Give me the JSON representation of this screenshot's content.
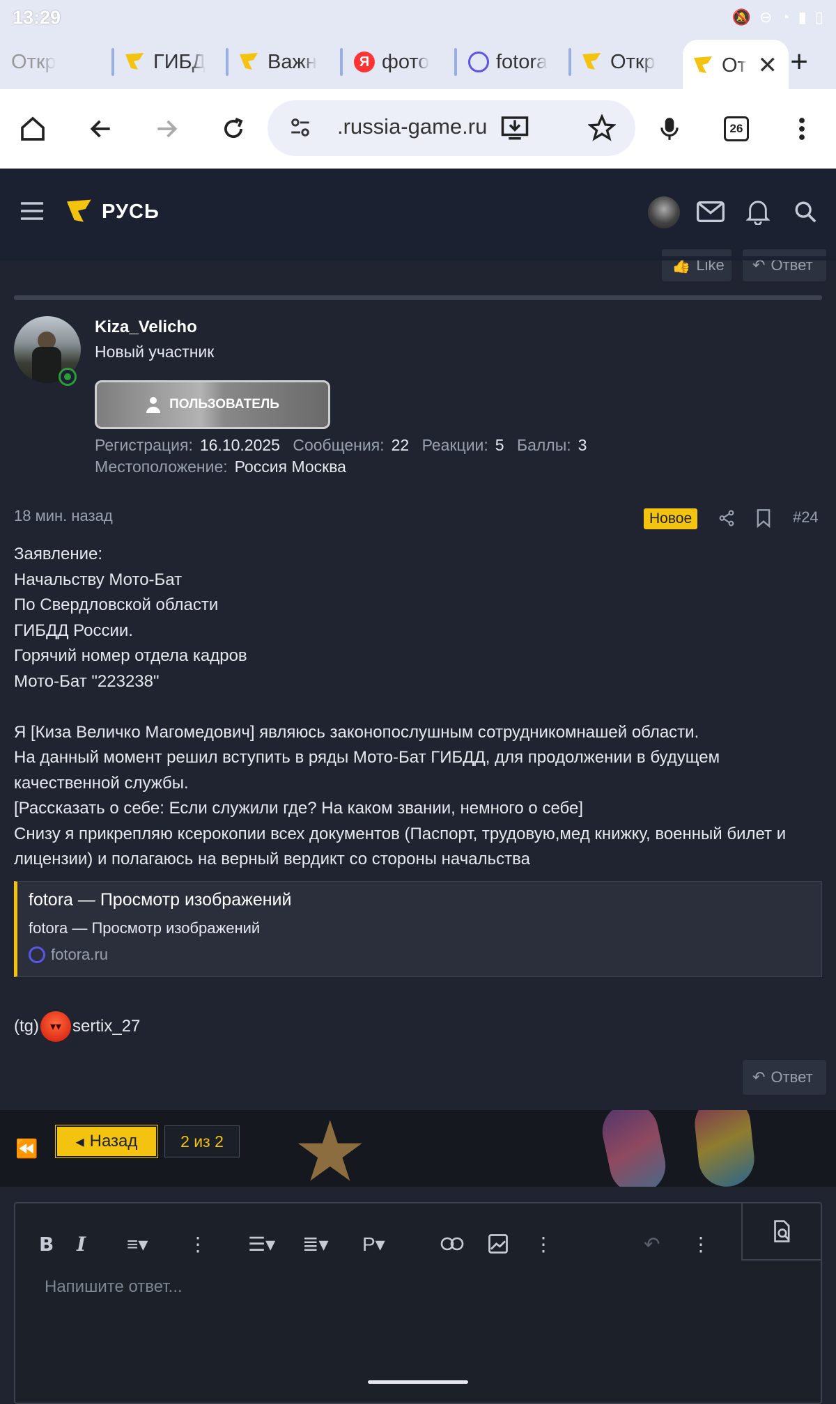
{
  "status_bar": {
    "time": "13:29"
  },
  "tabs": [
    {
      "label": "Откр",
      "icon": "flag-icon",
      "dim": true
    },
    {
      "label": "ГИБД",
      "icon": "flag-icon"
    },
    {
      "label": "Важн",
      "icon": "flag-icon"
    },
    {
      "label": "фото",
      "icon": "yandex-icon"
    },
    {
      "label": "fotora",
      "icon": "ring-icon"
    },
    {
      "label": "Откр",
      "icon": "flag-icon"
    },
    {
      "label": "От",
      "icon": "flag-icon",
      "active": true
    }
  ],
  "toolbar": {
    "url": ".russia-game.ru",
    "tab_count": "26"
  },
  "site": {
    "logo_text": "РУСЬ",
    "brand_color": "#f4c30f"
  },
  "actions": {
    "like_label": "Like",
    "reply_label": "Ответ"
  },
  "user": {
    "name": "Kiza_Velicho",
    "title": "Новый участник",
    "role": "ПОЛЬЗОВАТЕЛЬ",
    "stats": [
      {
        "key": "Регистрация:",
        "value": "16.10.2025"
      },
      {
        "key": "Сообщения:",
        "value": "22"
      },
      {
        "key": "Реакции:",
        "value": "5"
      },
      {
        "key": "Баллы:",
        "value": "3"
      }
    ],
    "location_key": "Местоположение:",
    "location_value": "Россия Москва"
  },
  "post": {
    "date": "18 мин. назад",
    "badge": "Новое",
    "number": "#24",
    "body": "Заявление:\nНачальству Мото-Бат\nПо Свердловской области\nГИБДД России.\nГорячий номер отдела кадров\nМото-Бат \"223238\"\n\nЯ [Киза Величко Магомедович] являюсь законопослушным сотрудникомнашей области.\nНа данный момент решил вступить в ряды Мото-Бат ГИБДД, для продолжении в будущем качественной службы.\n[Рассказать о себе: Если служили где? На каком звании, немного о себе]\nСнизу я прикрепляю ксерокопии всех документов (Паспорт, трудовую,мед книжку, военный билет и лицензии) и полагаюсь на верный вердикт со стороны начальства",
    "link_card": {
      "title": "fotora — Просмотр изображений",
      "description": "fotora — Просмотр изображений",
      "domain": "fotora.ru"
    },
    "signature_prefix": "(tg)",
    "signature_suffix": "sertix_27",
    "reply_label": "Ответ"
  },
  "pager": {
    "back_label": "Назад",
    "page_indicator": "2 из 2"
  },
  "editor": {
    "placeholder": "Напишите ответ..."
  }
}
